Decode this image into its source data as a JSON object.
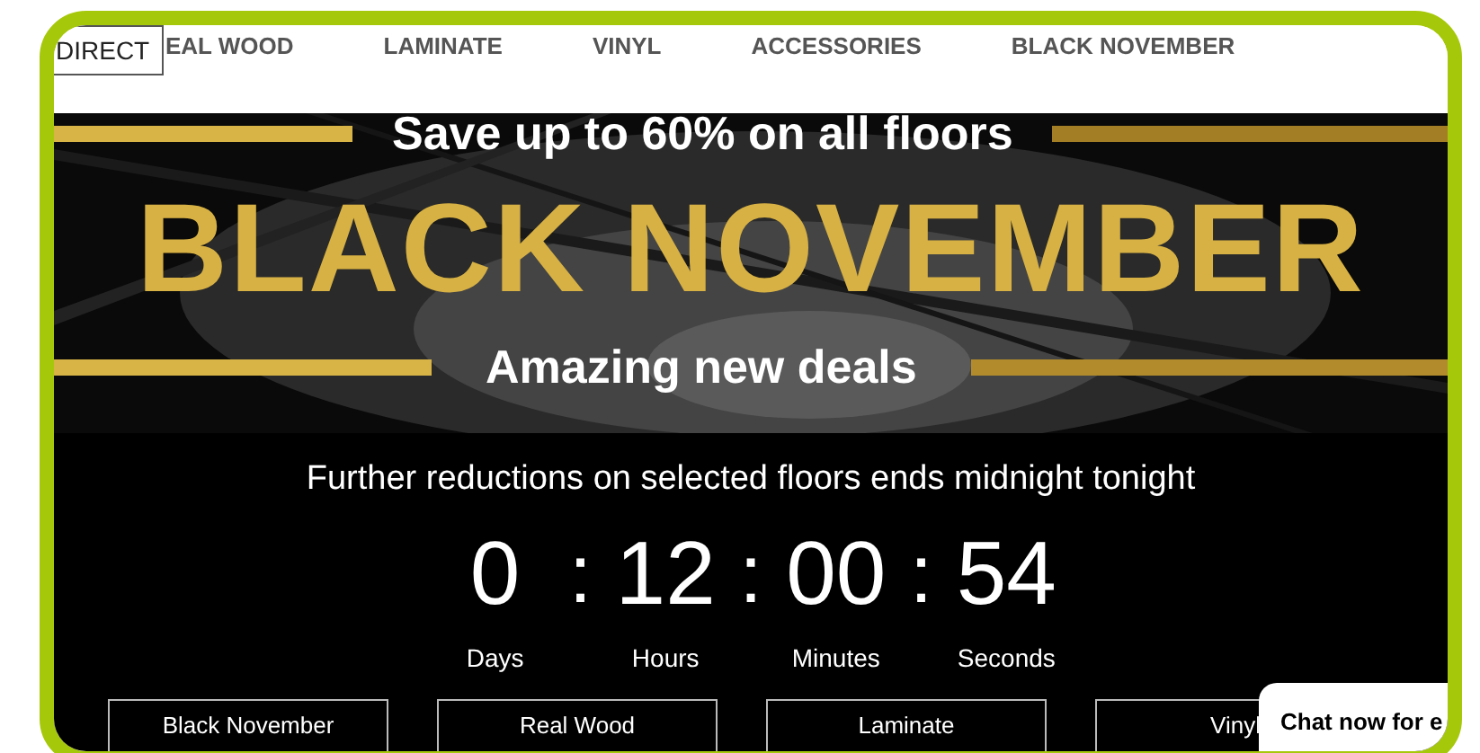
{
  "nav": {
    "logo_fragment": "DIRECT",
    "items": [
      "EAL WOOD",
      "LAMINATE",
      "VINYL",
      "ACCESSORIES",
      "BLACK NOVEMBER"
    ]
  },
  "banner": {
    "tagline": "Save up to 60% on all floors",
    "title": "BLACK NOVEMBER",
    "subtitle": "Amazing new deals"
  },
  "notice": "Further reductions on selected floors ends midnight tonight",
  "countdown": [
    {
      "value": "0",
      "label": "Days"
    },
    {
      "value": "12",
      "label": "Hours"
    },
    {
      "value": "00",
      "label": "Minutes"
    },
    {
      "value": "54",
      "label": "Seconds"
    }
  ],
  "separator": ":",
  "buttons": [
    "Black November",
    "Real Wood",
    "Laminate",
    "Vinyl"
  ],
  "chat": "Chat now for e"
}
